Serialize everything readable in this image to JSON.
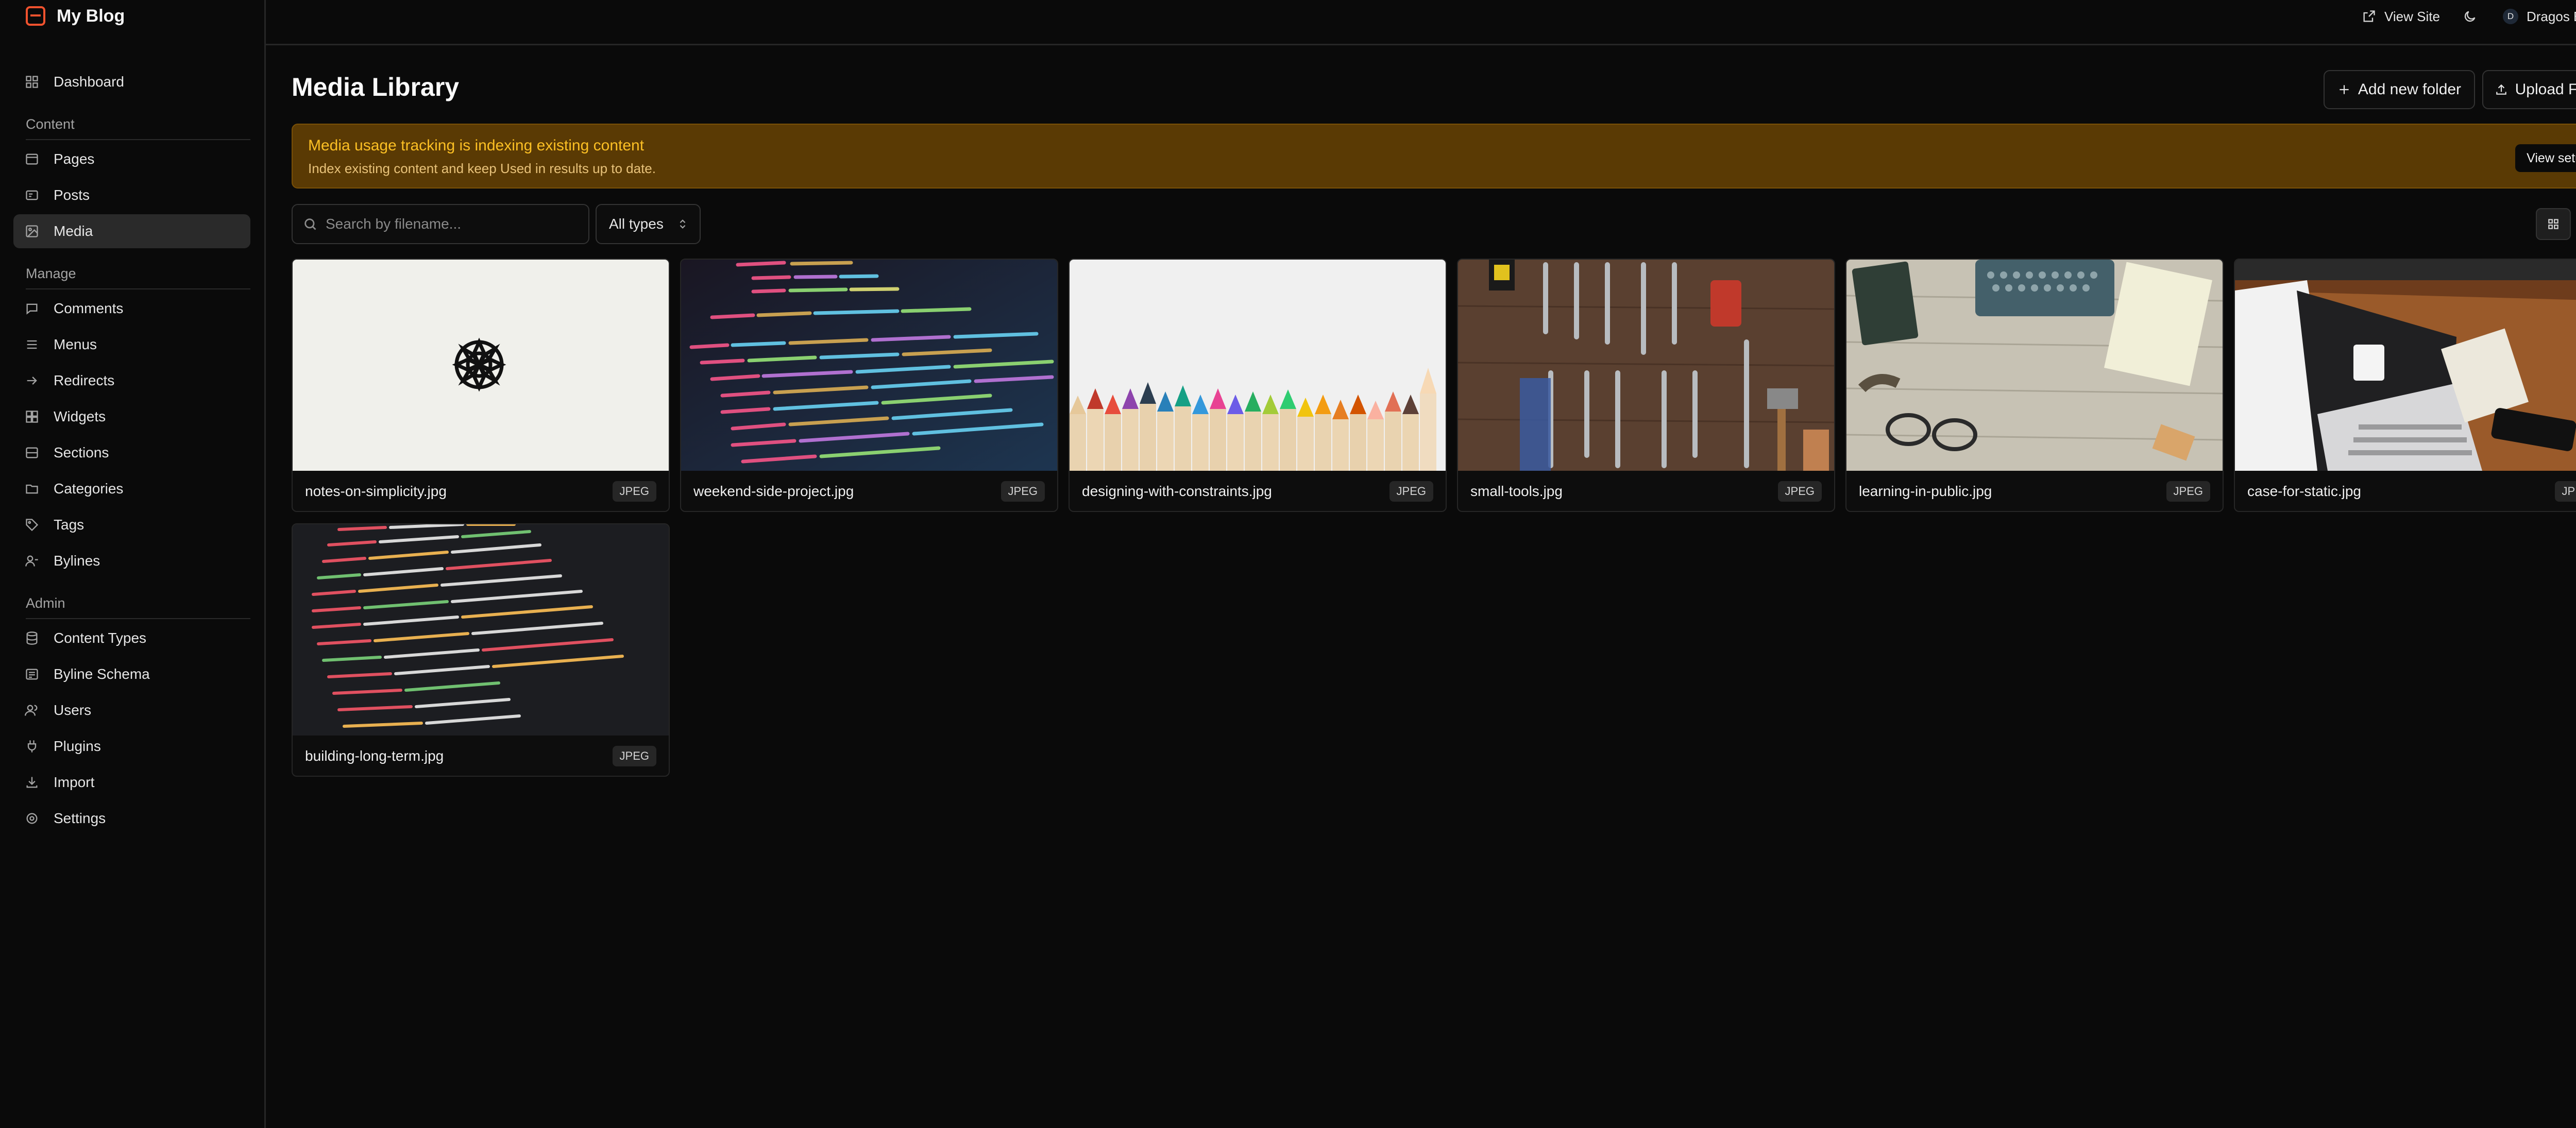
{
  "brand": {
    "name": "My Blog"
  },
  "topbar": {
    "view_site": "View Site",
    "user_initial": "D",
    "user_name": "Dragos Balota"
  },
  "sidebar": {
    "top": [
      {
        "label": "Dashboard",
        "icon": "dashboard-icon"
      }
    ],
    "sections": [
      {
        "title": "Content",
        "items": [
          {
            "label": "Pages",
            "icon": "pages-icon"
          },
          {
            "label": "Posts",
            "icon": "posts-icon"
          },
          {
            "label": "Media",
            "icon": "media-icon",
            "active": true
          }
        ]
      },
      {
        "title": "Manage",
        "items": [
          {
            "label": "Comments",
            "icon": "comments-icon"
          },
          {
            "label": "Menus",
            "icon": "menus-icon"
          },
          {
            "label": "Redirects",
            "icon": "redirects-icon"
          },
          {
            "label": "Widgets",
            "icon": "widgets-icon"
          },
          {
            "label": "Sections",
            "icon": "sections-icon"
          },
          {
            "label": "Categories",
            "icon": "categories-icon"
          },
          {
            "label": "Tags",
            "icon": "tags-icon"
          },
          {
            "label": "Bylines",
            "icon": "bylines-icon"
          }
        ]
      },
      {
        "title": "Admin",
        "items": [
          {
            "label": "Content Types",
            "icon": "database-icon"
          },
          {
            "label": "Byline Schema",
            "icon": "schema-icon"
          },
          {
            "label": "Users",
            "icon": "users-icon"
          },
          {
            "label": "Plugins",
            "icon": "plug-icon"
          },
          {
            "label": "Import",
            "icon": "import-icon"
          },
          {
            "label": "Settings",
            "icon": "gear-icon"
          }
        ]
      }
    ]
  },
  "main": {
    "title": "Media Library",
    "add_folder_label": "Add new folder",
    "upload_label": "Upload Files",
    "banner": {
      "title": "Media usage tracking is indexing existing content",
      "subtitle": "Index existing content and keep Used in results up to date.",
      "button": "View setup"
    },
    "search_placeholder": "Search by filename...",
    "type_filter": "All types",
    "view_mode": "grid"
  },
  "media": [
    {
      "name": "notes-on-simplicity.jpg",
      "type": "JPEG"
    },
    {
      "name": "weekend-side-project.jpg",
      "type": "JPEG"
    },
    {
      "name": "designing-with-constraints.jpg",
      "type": "JPEG"
    },
    {
      "name": "small-tools.jpg",
      "type": "JPEG"
    },
    {
      "name": "learning-in-public.jpg",
      "type": "JPEG"
    },
    {
      "name": "case-for-static.jpg",
      "type": "JPEG"
    },
    {
      "name": "building-long-term.jpg",
      "type": "JPEG"
    }
  ],
  "colors": {
    "accent": "#f0522e",
    "banner_bg": "#5a3a04",
    "banner_title": "#fbbf24"
  }
}
